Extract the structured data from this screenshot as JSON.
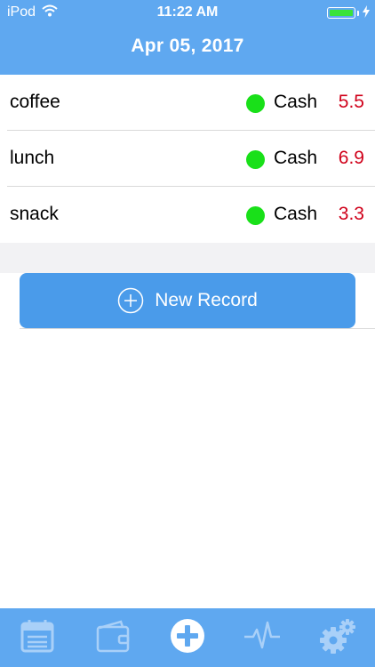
{
  "status_bar": {
    "carrier": "iPod",
    "time": "11:22 AM",
    "battery_color": "#3ae33a"
  },
  "nav": {
    "title": "Apr 05, 2017"
  },
  "records": [
    {
      "name": "coffee",
      "method": "Cash",
      "amount": "5.5"
    },
    {
      "name": "lunch",
      "method": "Cash",
      "amount": "6.9"
    },
    {
      "name": "snack",
      "method": "Cash",
      "amount": "3.3"
    }
  ],
  "new_record_button": {
    "label": "New Record",
    "icon": "plus-circle-icon"
  },
  "tab_bar": {
    "tabs": [
      {
        "name": "calendar",
        "icon": "calendar-icon"
      },
      {
        "name": "wallet",
        "icon": "wallet-icon"
      },
      {
        "name": "add",
        "icon": "add-icon"
      },
      {
        "name": "stats",
        "icon": "pulse-icon"
      },
      {
        "name": "settings",
        "icon": "gear-icon"
      }
    ]
  },
  "colors": {
    "header": "#5fa8f0",
    "button": "#4a9bea",
    "amount": "#d0021b",
    "status_dot": "#19e019"
  }
}
